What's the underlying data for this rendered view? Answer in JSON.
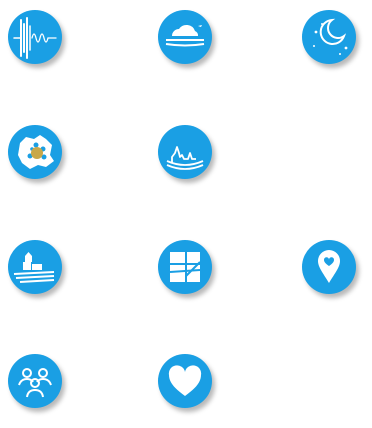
{
  "theme": {
    "accent": "#1a9fe4",
    "glyph": "#ffffff",
    "highlight": "#c8a84a",
    "background": "#ffffff"
  },
  "icons": [
    {
      "id": "seismic-signal-icon"
    },
    {
      "id": "cloud-weather-icon"
    },
    {
      "id": "night-moon-stars-icon"
    },
    {
      "id": "region-map-flower-icon"
    },
    {
      "id": "landscape-skyline-icon"
    },
    {
      "id": "agriculture-buildings-icon"
    },
    {
      "id": "window-grid-icon"
    },
    {
      "id": "location-pin-heart-icon"
    },
    {
      "id": "community-people-icon"
    },
    {
      "id": "heart-icon"
    }
  ]
}
